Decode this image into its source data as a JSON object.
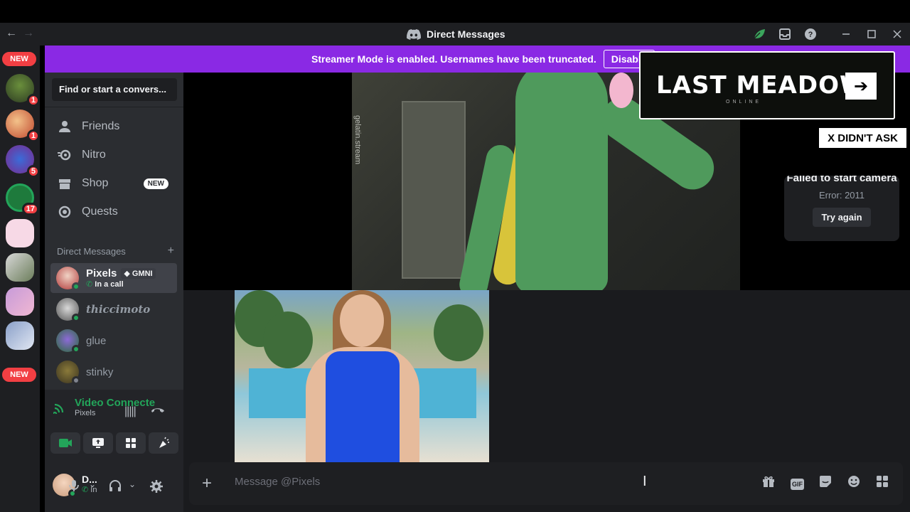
{
  "window": {
    "title": "Direct Messages",
    "nav_back": "←",
    "nav_forward": "→",
    "icons": [
      "leaf-icon",
      "inbox-icon",
      "help-icon",
      "minimize-icon",
      "maximize-icon",
      "close-icon"
    ]
  },
  "banner": {
    "text": "Streamer Mode is enabled. Usernames have been truncated.",
    "button": "Disable"
  },
  "servers": {
    "top_pill": "NEW",
    "bottom_pill": "NEW",
    "badges": [
      "1",
      "1",
      "5",
      "17"
    ]
  },
  "sidebar": {
    "search_placeholder": "Find or start a convers...",
    "nav": [
      {
        "label": "Friends",
        "icon": "friends-icon"
      },
      {
        "label": "Nitro",
        "icon": "nitro-icon"
      },
      {
        "label": "Shop",
        "icon": "shop-icon",
        "tag": "NEW"
      },
      {
        "label": "Quests",
        "icon": "quests-icon"
      }
    ],
    "dm_header": "Direct Messages",
    "dm_add": "+",
    "dms": [
      {
        "name": "Pixels",
        "tag": "GMNI",
        "status": "In a call",
        "active": true
      },
      {
        "name": "thiccimoto"
      },
      {
        "name": "glue"
      },
      {
        "name": "stinky"
      }
    ]
  },
  "voice": {
    "title": "Video Connecte",
    "subtitle": "Pixels"
  },
  "user": {
    "name": "D...",
    "status": "In"
  },
  "main": {
    "video_watermark": "gelatin.stream",
    "ad_title": "LAST MEADOW",
    "ad_subtitle": "ONLINE",
    "ad_arrow": "➔",
    "overlay_button": "X DIDN'T ASK",
    "camera_error_title": "Failed to start camera",
    "camera_error_code": "Error: 2011",
    "camera_retry": "Try again"
  },
  "composer": {
    "placeholder": "Message @Pixels",
    "plus": "+",
    "gif": "GIF"
  },
  "colors": {
    "banner": "#8a29e4",
    "green": "#23a55a",
    "red_badge": "#f23f43"
  }
}
